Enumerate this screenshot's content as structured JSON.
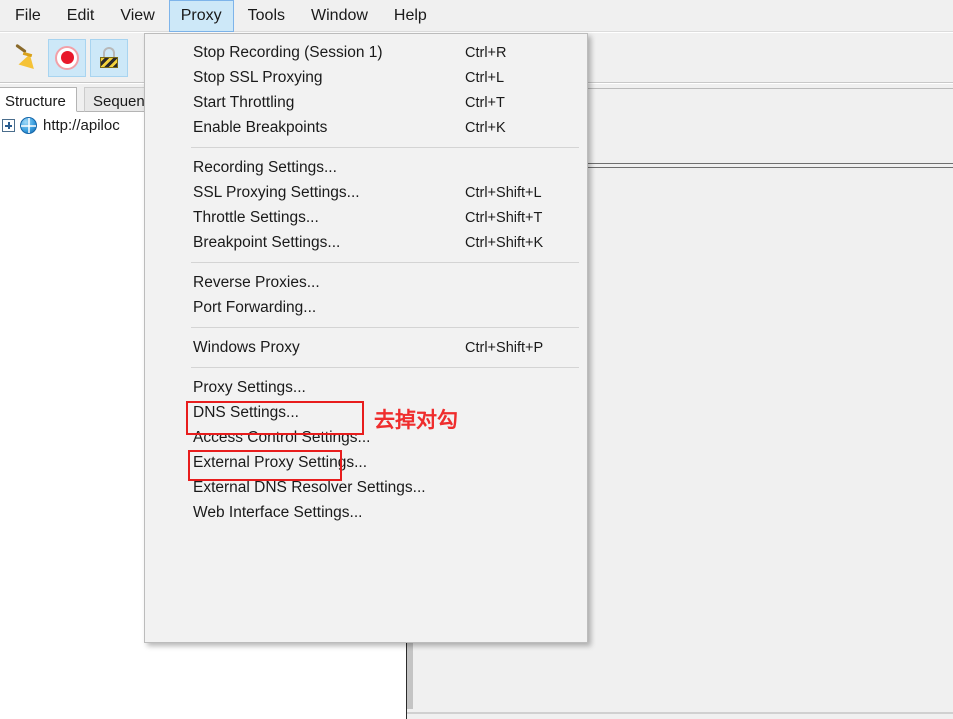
{
  "menubar": {
    "items": [
      {
        "label": "File",
        "active": false
      },
      {
        "label": "Edit",
        "active": false
      },
      {
        "label": "View",
        "active": false
      },
      {
        "label": "Proxy",
        "active": true
      },
      {
        "label": "Tools",
        "active": false
      },
      {
        "label": "Window",
        "active": false
      },
      {
        "label": "Help",
        "active": false
      }
    ]
  },
  "toolbar": {
    "buttons": [
      {
        "name": "clear-session-icon",
        "icon": "broom",
        "selected": false
      },
      {
        "name": "record-toggle-icon",
        "icon": "record",
        "selected": true
      },
      {
        "name": "ssl-proxying-icon",
        "icon": "lock",
        "selected": true
      }
    ]
  },
  "tabs": [
    {
      "label": "Structure",
      "active": true
    },
    {
      "label": "Sequence",
      "active": false
    }
  ],
  "tree": {
    "rows": [
      {
        "label": "http://apiloc",
        "expander": "+",
        "icon": "globe-icon"
      }
    ]
  },
  "proxy_menu": {
    "items": [
      {
        "type": "item",
        "label": "Stop Recording (Session 1)",
        "accel": "Ctrl+R"
      },
      {
        "type": "item",
        "label": "Stop SSL Proxying",
        "accel": "Ctrl+L"
      },
      {
        "type": "item",
        "label": "Start Throttling",
        "accel": "Ctrl+T"
      },
      {
        "type": "item",
        "label": "Enable Breakpoints",
        "accel": "Ctrl+K"
      },
      {
        "type": "separator"
      },
      {
        "type": "item",
        "label": "Recording Settings...",
        "accel": ""
      },
      {
        "type": "item",
        "label": "SSL Proxying Settings...",
        "accel": "Ctrl+Shift+L"
      },
      {
        "type": "item",
        "label": "Throttle Settings...",
        "accel": "Ctrl+Shift+T"
      },
      {
        "type": "item",
        "label": "Breakpoint Settings...",
        "accel": "Ctrl+Shift+K"
      },
      {
        "type": "separator"
      },
      {
        "type": "item",
        "label": "Reverse Proxies...",
        "accel": ""
      },
      {
        "type": "item",
        "label": "Port Forwarding...",
        "accel": ""
      },
      {
        "type": "separator"
      },
      {
        "type": "item",
        "label": "Windows Proxy",
        "accel": "Ctrl+Shift+P"
      },
      {
        "type": "separator"
      },
      {
        "type": "item",
        "label": "Proxy Settings...",
        "accel": ""
      },
      {
        "type": "item",
        "label": "DNS Settings...",
        "accel": ""
      },
      {
        "type": "item",
        "label": "Access Control Settings...",
        "accel": ""
      },
      {
        "type": "item",
        "label": "External Proxy Settings...",
        "accel": ""
      },
      {
        "type": "item",
        "label": "External DNS Resolver Settings...",
        "accel": ""
      },
      {
        "type": "item",
        "label": "Web Interface Settings...",
        "accel": ""
      }
    ]
  },
  "annotations": {
    "chinese_note": "去掉对勾",
    "highlight_color": "#e81d1d"
  },
  "colors": {
    "menu_bg": "#f2f2f2",
    "panel_bg": "#f0f0f0",
    "accent_blue": "#cde8f8",
    "annotation_red": "#e81d1d",
    "record_red": "#e8182a"
  }
}
